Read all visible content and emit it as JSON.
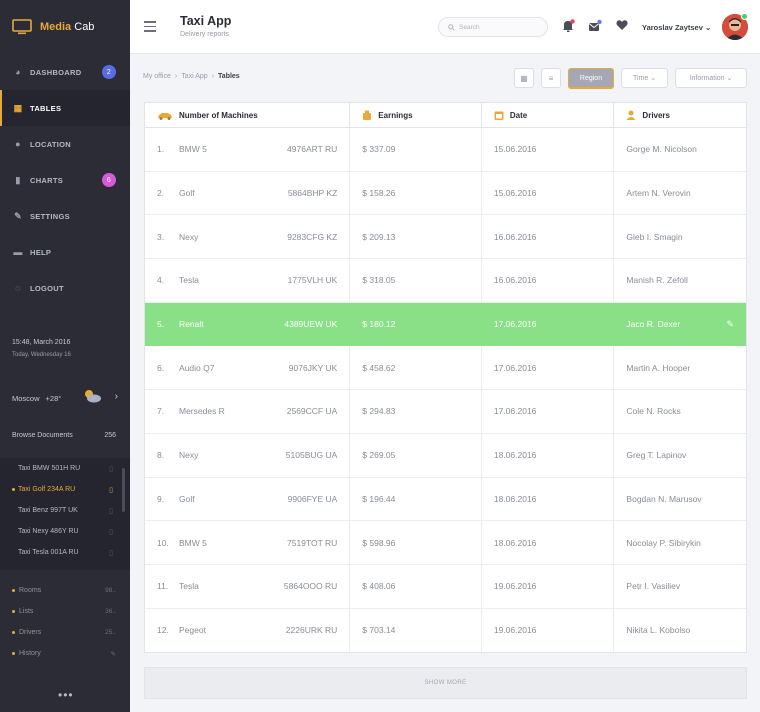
{
  "app": {
    "brand_part1": "Media",
    "brand_part2": "Cab",
    "title": "Taxi App",
    "subtitle": "Delivery reports"
  },
  "sidebar": {
    "items": [
      {
        "label": "DASHBOARD",
        "icon": "dashboard-icon",
        "badge": "2"
      },
      {
        "label": "TABLES",
        "icon": "tables-icon",
        "active": true
      },
      {
        "label": "LOCATION",
        "icon": "location-pin-icon"
      },
      {
        "label": "CHARTS",
        "icon": "bar-chart-icon",
        "badge": "6"
      },
      {
        "label": "SETTINGS",
        "icon": "wrench-icon"
      },
      {
        "label": "HELP",
        "icon": "help-icon"
      },
      {
        "label": "LOGOUT",
        "icon": "logout-icon"
      }
    ],
    "clock": {
      "time": "15:48, March 2016",
      "day": "Today, Wednesday 16"
    },
    "weather": {
      "city": "Moscow",
      "temp": "+28°"
    },
    "browse": {
      "label": "Browse Documents",
      "count": "256"
    },
    "documents": [
      "Taxi BMW 501H RU",
      "Taxi Golf 234A RU",
      "Taxi Benz 997T UK",
      "Taxi Nexy 486Y RU",
      "Taxi Tesla 001A RU"
    ],
    "stats": [
      {
        "label": "Rooms",
        "value": "98.."
      },
      {
        "label": "Lists",
        "value": "36.."
      },
      {
        "label": "Drivers",
        "value": "25.."
      },
      {
        "label": "History",
        "value": ""
      }
    ],
    "more": "•••"
  },
  "header": {
    "search_placeholder": "Search",
    "user_name": "Yaroslav Zaytsev"
  },
  "breadcrumb": [
    "My office",
    "Taxi App",
    "Tables"
  ],
  "toolbar": {
    "region": "Region",
    "time": "Time",
    "information": "Information"
  },
  "table": {
    "columns": [
      "Number of Machines",
      "Earnings",
      "Date",
      "Drivers"
    ],
    "rows": [
      {
        "n": "1.",
        "car": "BMW 5",
        "plate": "4976ART RU",
        "earn": "$ 337.09",
        "date": "15.06.2016",
        "driver": "Gorge M. Nicolson"
      },
      {
        "n": "2.",
        "car": "Golf",
        "plate": "5864BHP KZ",
        "earn": "$ 158.26",
        "date": "15.06.2016",
        "driver": "Artem N. Verovin"
      },
      {
        "n": "3.",
        "car": "Nexy",
        "plate": "9283CFG KZ",
        "earn": "$ 209.13",
        "date": "16.06.2016",
        "driver": "Gleb I. Smagin"
      },
      {
        "n": "4.",
        "car": "Tesla",
        "plate": "1775VLH UK",
        "earn": "$ 318.05",
        "date": "16.06.2016",
        "driver": "Manish R. Zefoll"
      },
      {
        "n": "5.",
        "car": "Renalt",
        "plate": "4389UEW UK",
        "earn": "$ 180.12",
        "date": "17.06.2016",
        "driver": "Jaco R. Dexer"
      },
      {
        "n": "6.",
        "car": "Audio Q7",
        "plate": "9076JKY UK",
        "earn": "$ 458.62",
        "date": "17.06.2016",
        "driver": "Martin A. Hooper"
      },
      {
        "n": "7.",
        "car": "Mersedes R",
        "plate": "2569CCF UA",
        "earn": "$ 294.83",
        "date": "17.06.2016",
        "driver": "Cole N. Rocks"
      },
      {
        "n": "8.",
        "car": "Nexy",
        "plate": "5105BUG UA",
        "earn": "$ 269.05",
        "date": "18.06.2016",
        "driver": "Greg T. Lapinov"
      },
      {
        "n": "9.",
        "car": "Golf",
        "plate": "9906FYE UA",
        "earn": "$ 196.44",
        "date": "18.06.2016",
        "driver": "Bogdan N. Marusov"
      },
      {
        "n": "10.",
        "car": "BMW 5",
        "plate": "7519TOT RU",
        "earn": "$ 598.96",
        "date": "18.06.2016",
        "driver": "Nocolay P. Sibirykin"
      },
      {
        "n": "11.",
        "car": "Tesla",
        "plate": "5864OOO RU",
        "earn": "$ 408.06",
        "date": "19.06.2016",
        "driver": "Petr I. Vasiliev"
      },
      {
        "n": "12.",
        "car": "Pegeot",
        "plate": "2226URK RU",
        "earn": "$ 703.14",
        "date": "19.06.2016",
        "driver": "Nikita L. Kobolso"
      }
    ],
    "show_more": "SHOW MORE"
  },
  "colors": {
    "accent": "#e8a93a",
    "sidebar_bg": "#2b2c36",
    "highlight_row": "#89e086",
    "badge_blue": "#5b6be6",
    "badge_pink": "#d65ad8"
  }
}
